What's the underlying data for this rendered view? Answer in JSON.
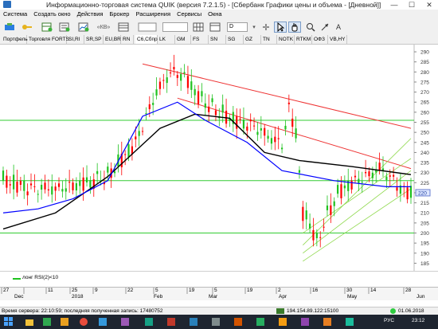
{
  "window": {
    "title": "Информационно-торговая система QUIK (версия 7.2.1.5) - [Сбербанк Графики цены и объема - [Дневной]]",
    "min_glyph": "—",
    "max_glyph": "☐",
    "close_glyph": "✕"
  },
  "menu": [
    "Система",
    "Создать окно",
    "Действия",
    "Брокер",
    "Расширения",
    "Сервисы",
    "Окна"
  ],
  "toolbar": {
    "period_value": "D",
    "nnkb_label": "«КВ»"
  },
  "tabs": [
    "Портфель",
    "Торговля FORTS",
    "SI,RI",
    "SR,SP",
    "EU,BR",
    "RN",
    "C6,Сбпр",
    "LK",
    "GM",
    "FS",
    "SN",
    "SG",
    "GZ",
    "TN",
    "NOTK",
    "RTKM",
    "ОФЗ",
    "VB,HY"
  ],
  "active_tab": "C6,Сбпр",
  "chart_data": {
    "type": "candlestick",
    "instrument": "Сбербанк",
    "timeframe": "Дневной",
    "y_ticks": [
      290,
      285,
      280,
      275,
      270,
      265,
      260,
      255,
      250,
      245,
      240,
      235,
      230,
      225,
      220,
      215,
      210,
      205,
      200,
      195,
      190,
      185
    ],
    "last_price_label": "220",
    "date_ticks": [
      "27",
      "11",
      "25",
      "9",
      "22",
      "5",
      "19",
      "5",
      "19",
      "2",
      "16",
      "30",
      "14",
      "28"
    ],
    "month_labels": [
      "Dec",
      "2018",
      "Feb",
      "Mar",
      "Apr",
      "May",
      "Jun"
    ],
    "horizontal_lines": [
      256,
      226,
      200
    ],
    "channel_upper": [
      [
        40,
        284
      ],
      [
        117,
        252
      ]
    ],
    "channel_lower": [
      [
        50,
        267
      ],
      [
        117,
        232
      ]
    ],
    "ma_short": [
      [
        0,
        210
      ],
      [
        10,
        212
      ],
      [
        20,
        217
      ],
      [
        30,
        226
      ],
      [
        40,
        258
      ],
      [
        50,
        265
      ],
      [
        58,
        256
      ],
      [
        70,
        245
      ],
      [
        80,
        231
      ],
      [
        95,
        226
      ],
      [
        110,
        223
      ],
      [
        117,
        223
      ]
    ],
    "ma_long": [
      [
        0,
        202
      ],
      [
        15,
        210
      ],
      [
        30,
        228
      ],
      [
        45,
        252
      ],
      [
        55,
        259
      ],
      [
        65,
        257
      ],
      [
        75,
        240
      ],
      [
        85,
        236
      ],
      [
        100,
        233
      ],
      [
        117,
        229
      ]
    ],
    "candle_summary": "daily candles Dec 2017 – Jun 2018, peak ~283 in Mar, low ~192 in Apr"
  },
  "indicator": {
    "label": "лонг RSI(2)<10"
  },
  "status": {
    "server_time": "Время сервера: 22:10:59; последняя полученная запись: 17480752",
    "connection": "194.154.89.122:15100",
    "date": "01.06.2018"
  },
  "taskbar": {
    "lang": "РУС",
    "clock": "23:12"
  },
  "colors": {
    "bull": "#1fc21f",
    "bear": "#ff0000",
    "ma_short": "#0000ff",
    "ma_long": "#000000",
    "channel": "#e33",
    "hline": "#3c3"
  }
}
